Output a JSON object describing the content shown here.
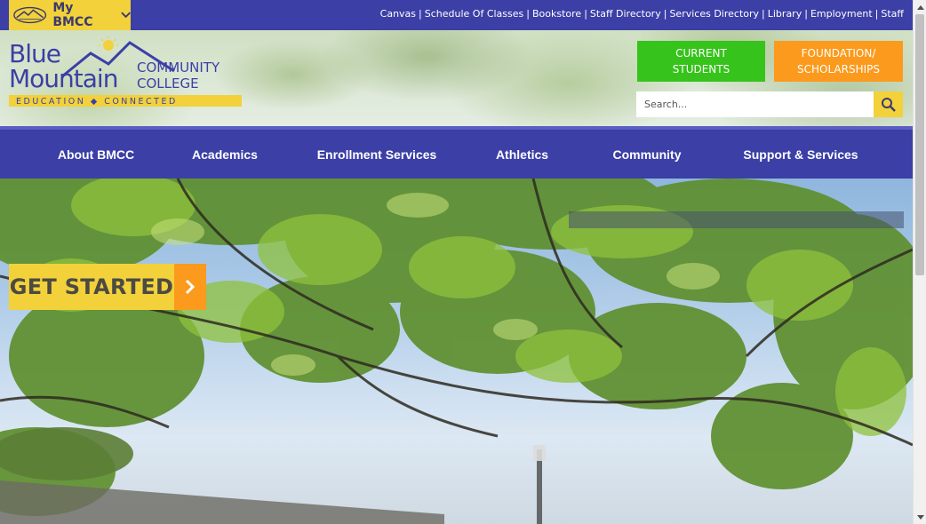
{
  "utility_bar": {
    "my_bmcc_label": "My BMCC",
    "links": [
      {
        "label": "Canvas"
      },
      {
        "label": "Schedule Of Classes"
      },
      {
        "label": "Bookstore"
      },
      {
        "label": "Staff Directory"
      },
      {
        "label": "Services Directory"
      },
      {
        "label": "Library"
      },
      {
        "label": "Employment"
      },
      {
        "label": "Staff"
      }
    ],
    "separator": "|"
  },
  "header": {
    "logo": {
      "line1": "Blue",
      "line2": "Mountain",
      "community": "COMMUNITY",
      "college": "COLLEGE",
      "tagline": "EDUCATION ◆ CONNECTED"
    },
    "current_students_label": "CURRENT STUDENTS",
    "current_students_line1": "CURRENT",
    "current_students_line2": "STUDENTS",
    "foundation_line1": "FOUNDATION/",
    "foundation_line2": "SCHOLARSHIPS",
    "search": {
      "placeholder": "Search..."
    }
  },
  "nav": {
    "items": [
      {
        "label": "About BMCC"
      },
      {
        "label": "Academics"
      },
      {
        "label": "Enrollment Services"
      },
      {
        "label": "Athletics"
      },
      {
        "label": "Community"
      },
      {
        "label": "Support & Services"
      }
    ]
  },
  "hero": {
    "cta_label": "GET STARTED"
  },
  "colors": {
    "brand_blue": "#3b3fa6",
    "brand_yellow": "#f2d13a",
    "brand_green": "#36c31b",
    "brand_orange": "#fb9a1c"
  },
  "icons": {
    "mybmcc": "mountain-logo-icon",
    "mybmcc_toggle": "chevron-down-icon",
    "search": "search-icon",
    "cta": "chevron-right-icon"
  }
}
